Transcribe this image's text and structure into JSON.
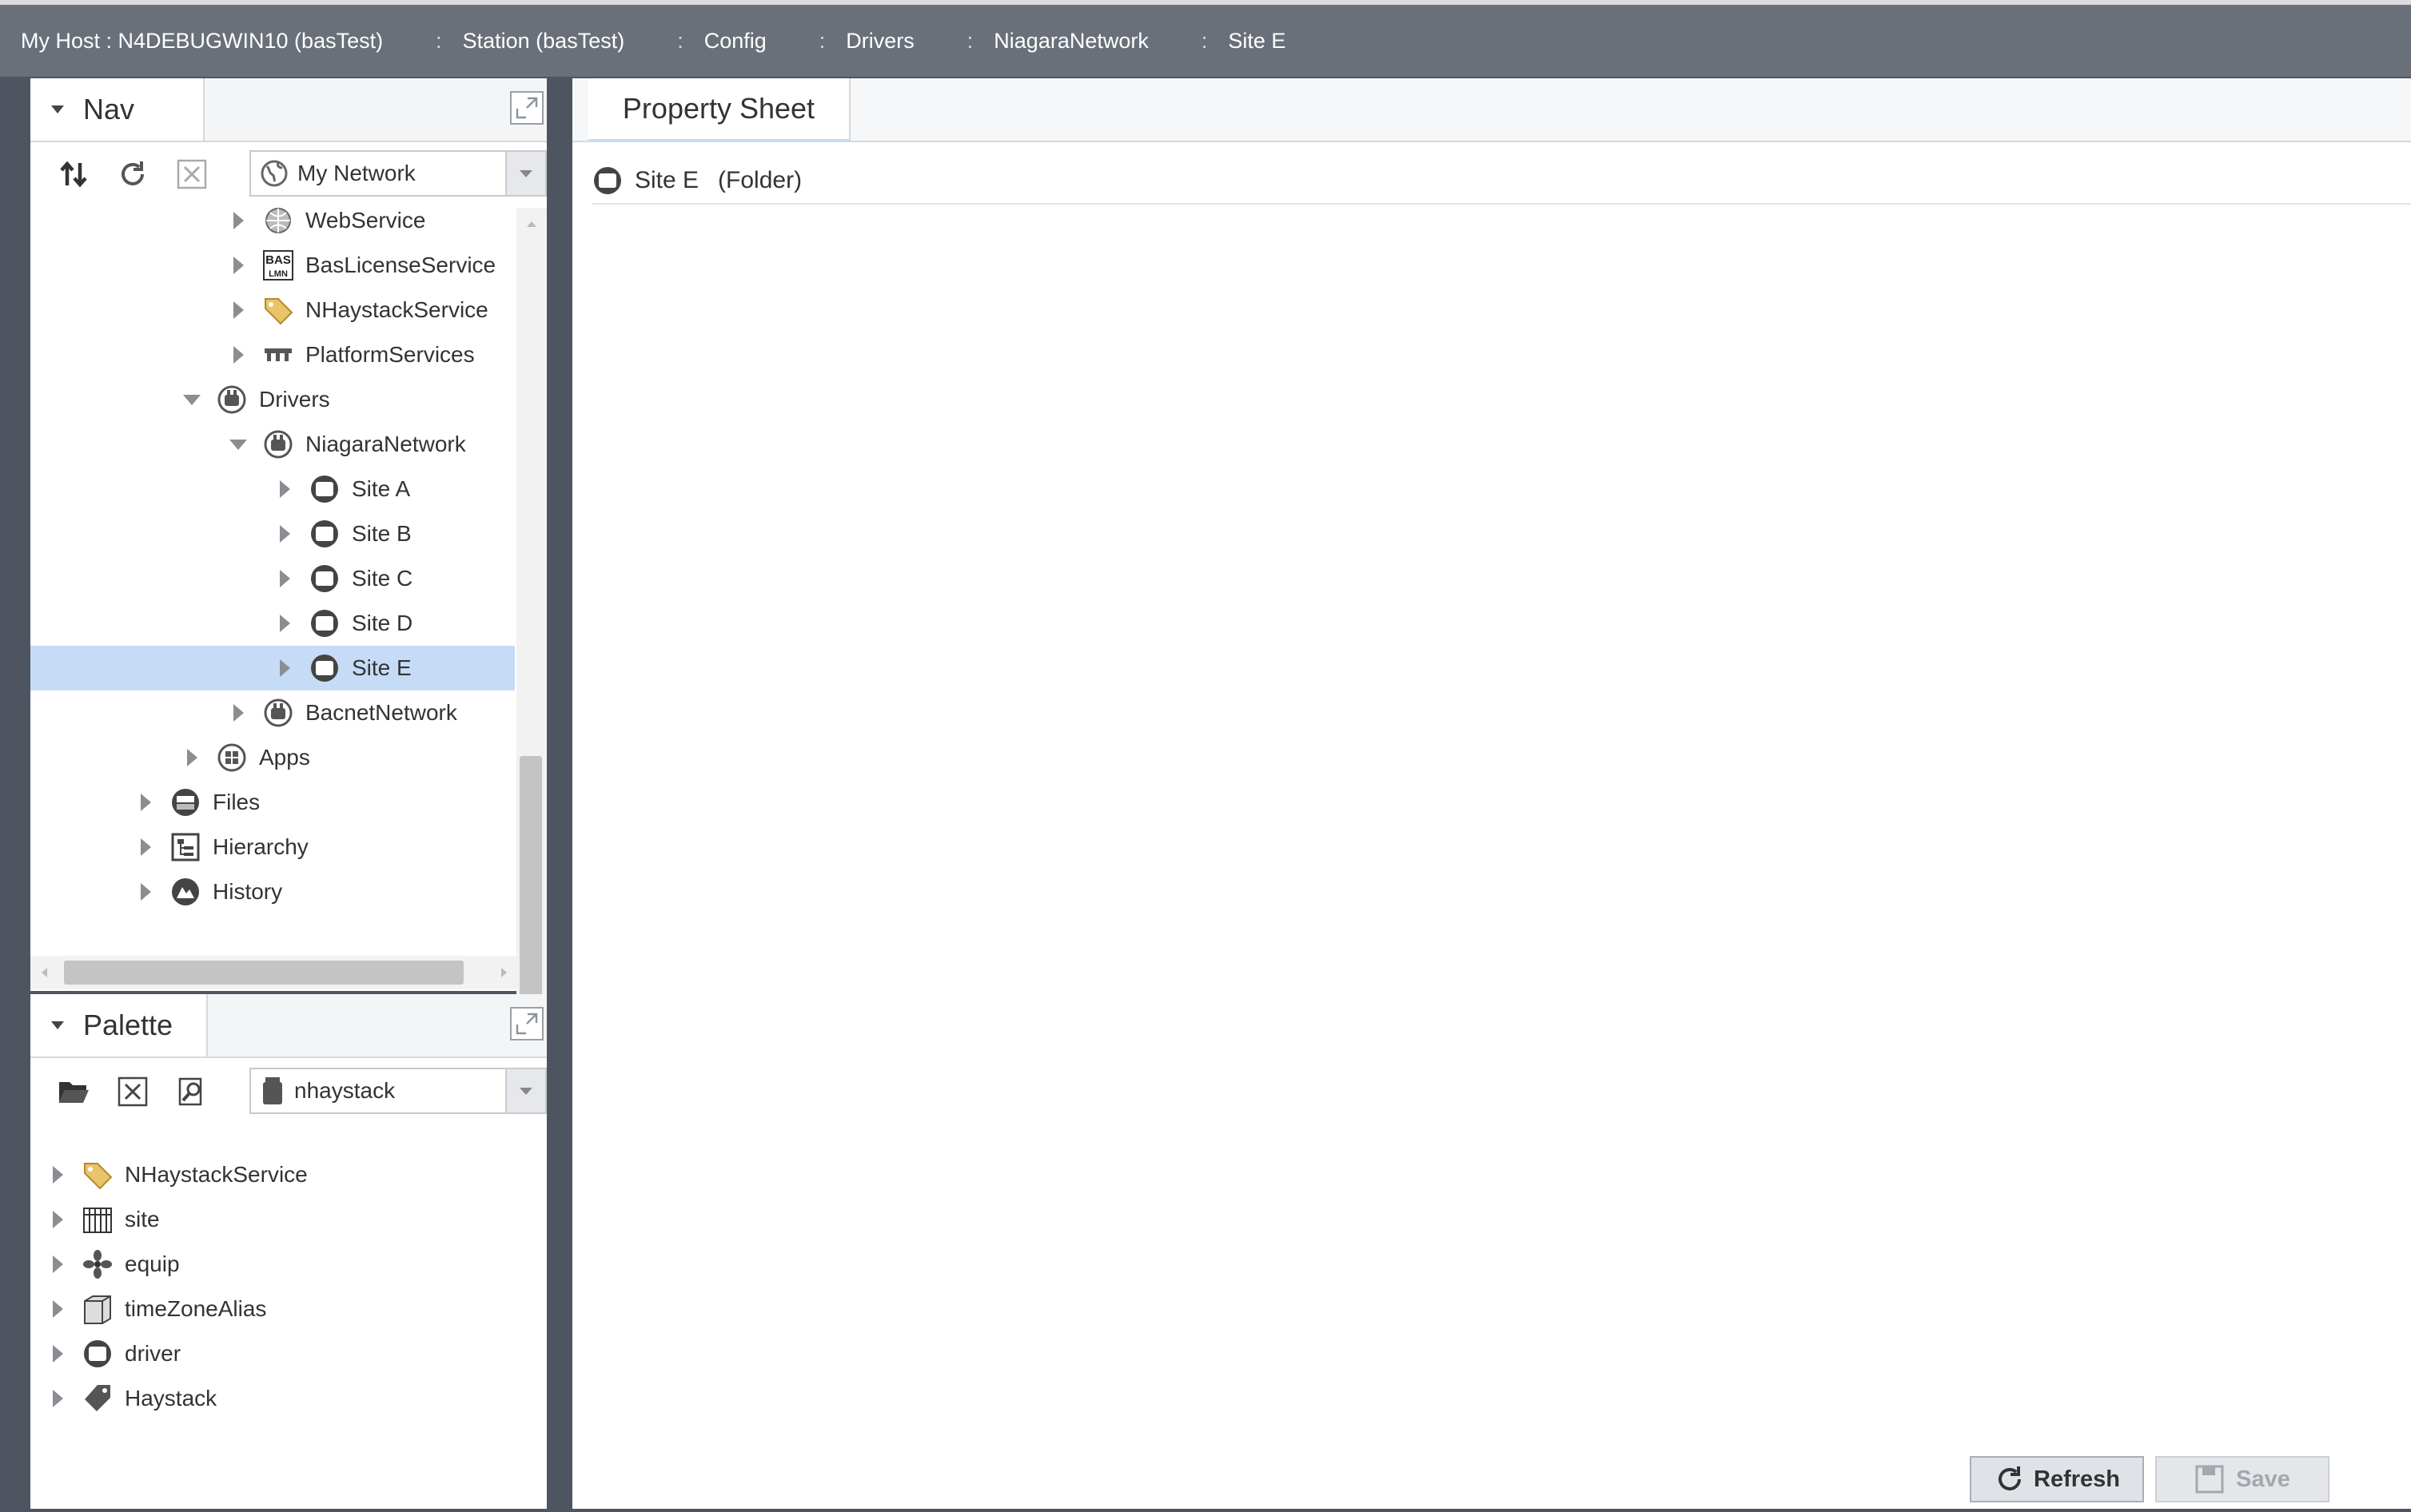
{
  "breadcrumb": [
    {
      "label": "My Host : N4DEBUGWIN10 (basTest)"
    },
    {
      "label": "Station (basTest)"
    },
    {
      "label": "Config"
    },
    {
      "label": "Drivers"
    },
    {
      "label": "NiagaraNetwork"
    },
    {
      "label": "Site E"
    }
  ],
  "nav": {
    "title": "Nav",
    "selector_value": "My Network",
    "tree": [
      {
        "label": "WebService",
        "icon": "web-service-icon"
      },
      {
        "label": "BasLicenseService",
        "icon": "license-icon"
      },
      {
        "label": "NHaystackService",
        "icon": "tag-icon"
      },
      {
        "label": "PlatformServices",
        "icon": "platform-icon"
      },
      {
        "label": "Drivers",
        "icon": "driver-container-icon"
      },
      {
        "label": "NiagaraNetwork",
        "icon": "network-icon"
      },
      {
        "label": "Site A",
        "icon": "folder-circle-icon"
      },
      {
        "label": "Site B",
        "icon": "folder-circle-icon"
      },
      {
        "label": "Site C",
        "icon": "folder-circle-icon"
      },
      {
        "label": "Site D",
        "icon": "folder-circle-icon"
      },
      {
        "label": "Site E",
        "icon": "folder-circle-icon",
        "selected": true
      },
      {
        "label": "BacnetNetwork",
        "icon": "network-icon"
      },
      {
        "label": "Apps",
        "icon": "apps-icon"
      },
      {
        "label": "Files",
        "icon": "files-icon"
      },
      {
        "label": "Hierarchy",
        "icon": "hierarchy-icon"
      },
      {
        "label": "History",
        "icon": "history-icon"
      }
    ]
  },
  "palette": {
    "title": "Palette",
    "selector_value": "nhaystack",
    "tree": [
      {
        "label": "NHaystackService",
        "icon": "tag-icon"
      },
      {
        "label": "site",
        "icon": "site-icon"
      },
      {
        "label": "equip",
        "icon": "equip-icon"
      },
      {
        "label": "timeZoneAlias",
        "icon": "timezone-alias-icon"
      },
      {
        "label": "driver",
        "icon": "folder-circle-icon"
      },
      {
        "label": "Haystack",
        "icon": "haystack-tag-icon"
      }
    ]
  },
  "property_sheet": {
    "tab_label": "Property Sheet",
    "object_name": "Site E",
    "object_type": "(Folder)",
    "refresh_label": "Refresh",
    "save_label": "Save"
  },
  "colors": {
    "topbar": "#6a707a",
    "selection": "#c6dcf6",
    "background": "#4f5560"
  }
}
